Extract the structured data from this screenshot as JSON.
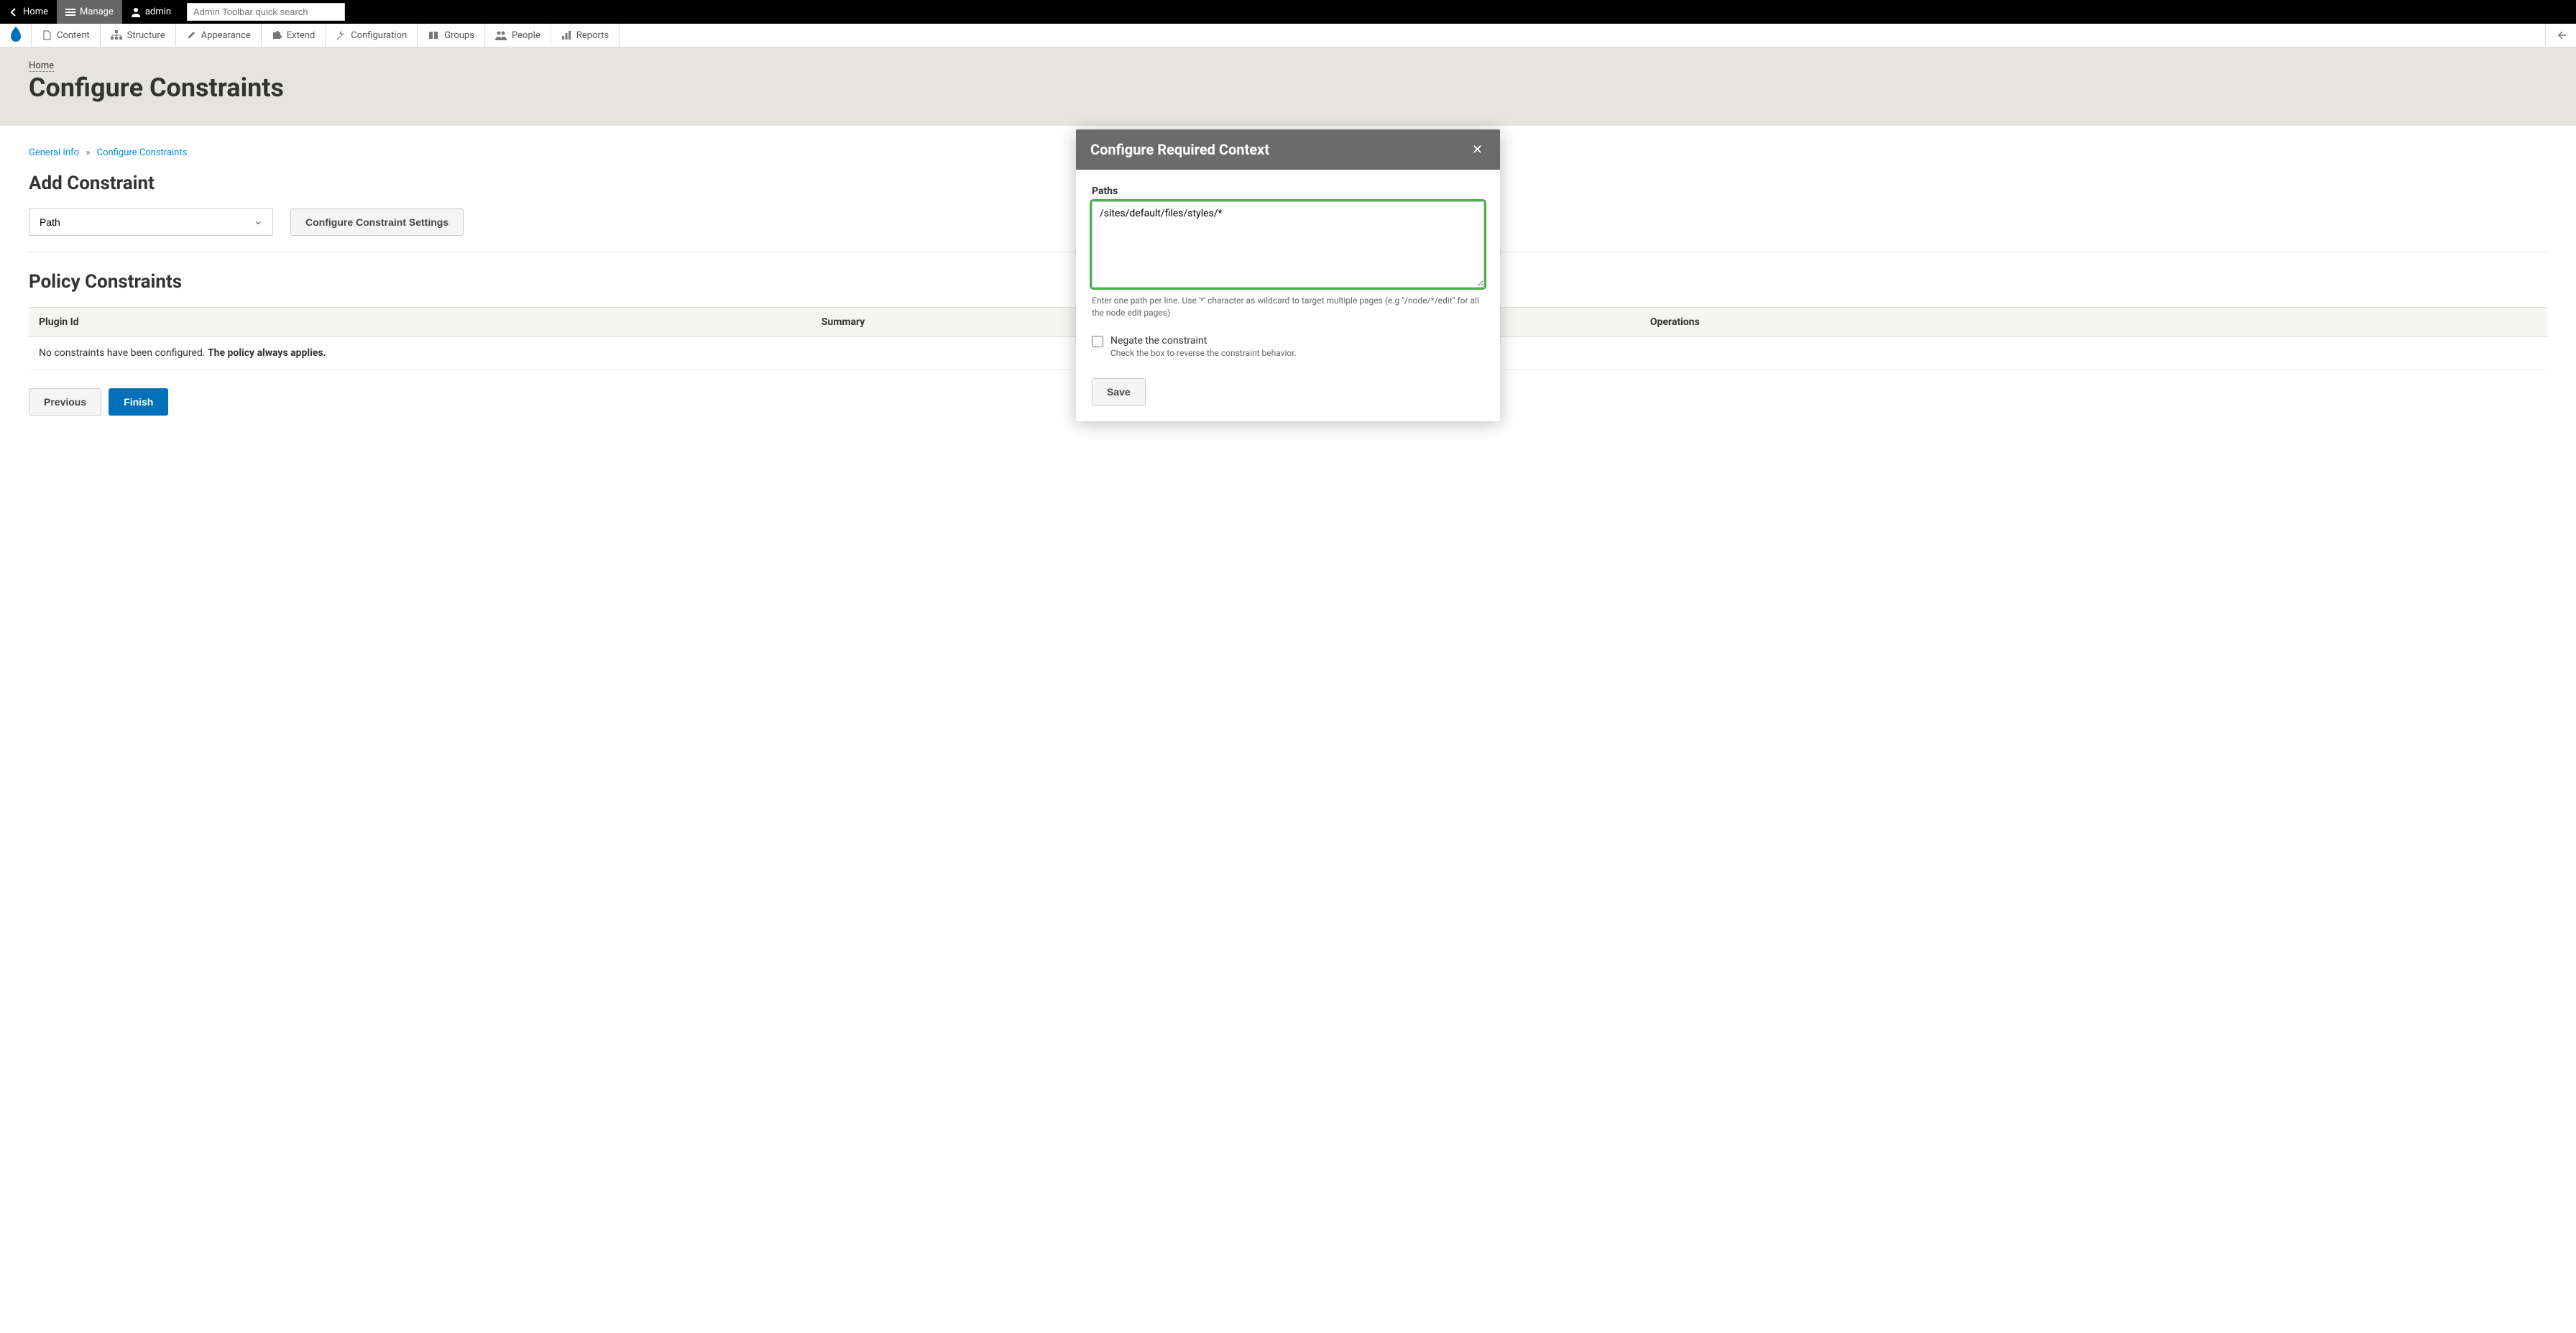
{
  "toolbar": {
    "home": "Home",
    "manage": "Manage",
    "admin": "admin",
    "search_placeholder": "Admin Toolbar quick search"
  },
  "admin_menu": {
    "items": [
      {
        "label": "Content"
      },
      {
        "label": "Structure"
      },
      {
        "label": "Appearance"
      },
      {
        "label": "Extend"
      },
      {
        "label": "Configuration"
      },
      {
        "label": "Groups"
      },
      {
        "label": "People"
      },
      {
        "label": "Reports"
      }
    ]
  },
  "header": {
    "breadcrumb_home": "Home",
    "page_title": "Configure Constraints"
  },
  "steps": {
    "general_info": "General Info",
    "separator": "»",
    "configure_constraints": "Configure Constraints"
  },
  "section": {
    "add_constraint_title": "Add Constraint",
    "select_value": "Path",
    "configure_button": "Configure Constraint Settings",
    "policy_constraints_title": "Policy Constraints"
  },
  "table": {
    "columns": [
      "Plugin Id",
      "Summary",
      "Operations"
    ],
    "empty_prefix": "No constraints have been configured. ",
    "empty_strong": "The policy always applies."
  },
  "actions": {
    "previous": "Previous",
    "finish": "Finish"
  },
  "modal": {
    "title": "Configure Required Context",
    "paths_label": "Paths",
    "paths_value": "/sites/default/files/styles/*",
    "paths_description": "Enter one path per line. Use '*' character as wildcard to target multiple pages (e.g \"/node/*/edit\" for all the node edit pages)",
    "negate_label": "Negate the constraint",
    "negate_description": "Check the box to reverse the constraint behavior.",
    "save": "Save"
  }
}
